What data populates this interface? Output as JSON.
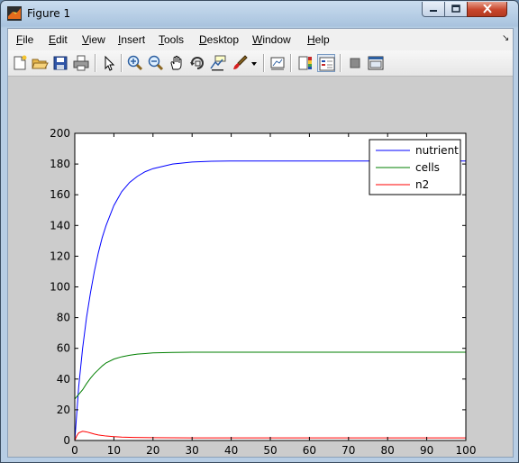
{
  "window": {
    "title": "Figure 1"
  },
  "menu": {
    "items": [
      {
        "key": "F",
        "rest": "ile"
      },
      {
        "key": "E",
        "rest": "dit"
      },
      {
        "key": "V",
        "rest": "iew"
      },
      {
        "key": "I",
        "rest": "nsert"
      },
      {
        "key": "T",
        "rest": "ools"
      },
      {
        "key": "D",
        "rest": "esktop"
      },
      {
        "key": "W",
        "rest": "indow"
      },
      {
        "key": "H",
        "rest": "elp"
      }
    ]
  },
  "toolbar": {
    "icons": [
      "new-figure-icon",
      "open-file-icon",
      "save-icon",
      "print-icon",
      "edit-plot-icon",
      "zoom-in-icon",
      "zoom-out-icon",
      "pan-icon",
      "rotate-3d-icon",
      "data-cursor-icon",
      "brush-icon",
      "brush-dropdown-icon",
      "link-plot-icon",
      "insert-colorbar-icon",
      "insert-legend-icon",
      "hide-plot-tools-icon",
      "show-plot-tools-icon"
    ]
  },
  "colors": {
    "nutrient": "#0000ff",
    "cells": "#007f00",
    "n2": "#ff0000",
    "figure_background": "#cccccc",
    "axes_background": "#ffffff"
  },
  "chart_data": {
    "type": "line",
    "title": "",
    "xlabel": "",
    "ylabel": "",
    "xlim": [
      0,
      100
    ],
    "ylim": [
      0,
      200
    ],
    "x_ticks": [
      0,
      10,
      20,
      30,
      40,
      50,
      60,
      70,
      80,
      90,
      100
    ],
    "y_ticks": [
      0,
      20,
      40,
      60,
      80,
      100,
      120,
      140,
      160,
      180,
      200
    ],
    "grid": false,
    "legend_position": "top-right",
    "series": [
      {
        "name": "nutrient",
        "x": [
          0,
          1,
          2,
          3,
          4,
          5,
          6,
          7,
          8,
          10,
          12,
          14,
          16,
          18,
          20,
          25,
          30,
          35,
          40,
          50,
          60,
          70,
          80,
          90,
          100
        ],
        "y": [
          0,
          35,
          60,
          80,
          96,
          110,
          122,
          132,
          140,
          153,
          162,
          168,
          172,
          175,
          177,
          180,
          181.3,
          181.8,
          182,
          182,
          182,
          182,
          182,
          182,
          182
        ]
      },
      {
        "name": "cells",
        "x": [
          0,
          1,
          2,
          3,
          4,
          5,
          6,
          7,
          8,
          10,
          12,
          14,
          16,
          18,
          20,
          25,
          30,
          40,
          50,
          60,
          70,
          80,
          90,
          100
        ],
        "y": [
          27,
          30,
          33,
          37,
          40.5,
          43.5,
          46,
          48.5,
          50.5,
          53,
          54.5,
          55.5,
          56.2,
          56.6,
          57,
          57.3,
          57.5,
          57.5,
          57.5,
          57.5,
          57.5,
          57.5,
          57.5,
          57.5
        ]
      },
      {
        "name": "n2",
        "x": [
          0,
          0.5,
          1,
          2,
          3,
          4,
          5,
          6,
          8,
          10,
          12,
          15,
          20,
          30,
          40,
          50,
          60,
          70,
          80,
          90,
          100
        ],
        "y": [
          0,
          3,
          5,
          6,
          5.6,
          4.9,
          4.2,
          3.6,
          2.9,
          2.5,
          2.2,
          2,
          1.8,
          1.7,
          1.7,
          1.7,
          1.7,
          1.7,
          1.7,
          1.7,
          1.7
        ]
      }
    ]
  }
}
